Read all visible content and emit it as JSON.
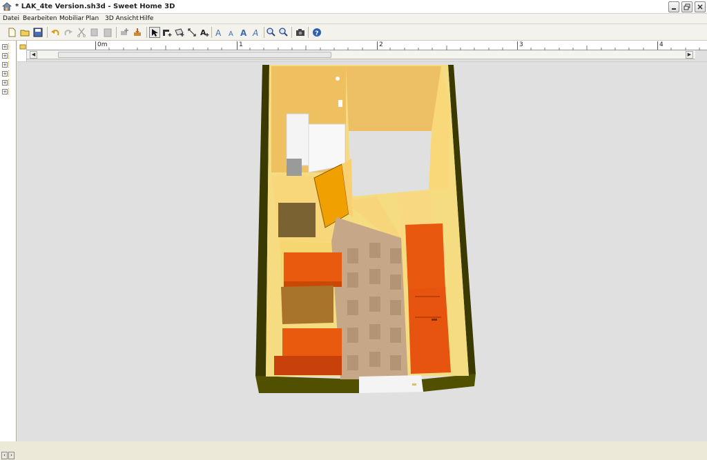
{
  "window": {
    "title": "* LAK_4te Version.sh3d - Sweet Home 3D"
  },
  "menu": [
    "Datei",
    "Bearbeiten",
    "Mobiliar",
    "Plan",
    "3D Ansicht",
    "Hilfe"
  ],
  "toolbar": {
    "buttons": [
      "new-icon",
      "open-icon",
      "save-icon",
      "undo-icon",
      "redo-icon",
      "cut-icon",
      "copy-icon",
      "paste-icon",
      "add-furniture-icon",
      "import-furniture-icon",
      "select-mode-icon",
      "create-walls-icon",
      "create-rooms-icon",
      "create-dimensions-icon",
      "create-labels-icon",
      "increase-text-icon",
      "decrease-text-icon",
      "bold-text-icon",
      "italic-text-icon",
      "zoom-in-icon",
      "zoom-out-icon",
      "create-photo-icon",
      "help-icon"
    ],
    "active": "select-mode-icon"
  },
  "ruler": {
    "labels": [
      "0m",
      "1",
      "2",
      "3",
      "4"
    ]
  },
  "tree": {
    "count": 6
  },
  "colors": {
    "wall_yellow": "#f5d77a",
    "floor_orange": "#eec06a",
    "furniture_orange": "#e85a10",
    "table_brown": "#a6702a",
    "tile": "#c7a98a"
  }
}
